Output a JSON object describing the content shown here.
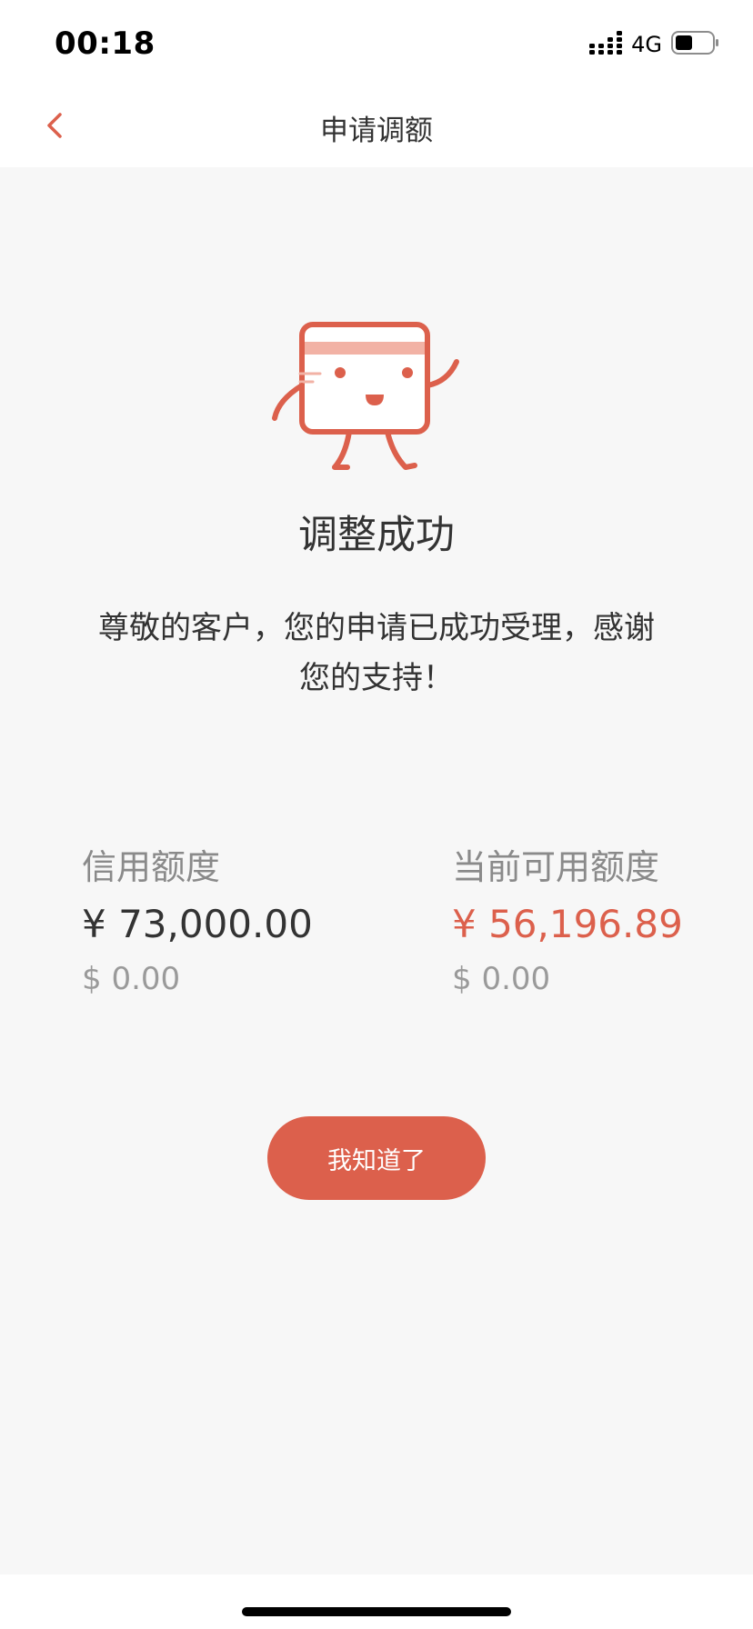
{
  "status_bar": {
    "time": "00:18",
    "network": "4G",
    "icons": [
      "signal-icon",
      "battery-icon"
    ]
  },
  "nav": {
    "title": "申请调额",
    "back_icon": "chevron-left-icon"
  },
  "result": {
    "illustration": "card-mascot-illustration",
    "title": "调整成功",
    "message": "尊敬的客户，您的申请已成功受理，感谢您的支持！"
  },
  "credit_limit": {
    "label": "信用额度",
    "cny": "¥ 73,000.00",
    "usd": "$ 0.00"
  },
  "available_limit": {
    "label": "当前可用额度",
    "cny": "¥ 56,196.89",
    "usd": "$ 0.00"
  },
  "actions": {
    "confirm_label": "我知道了"
  },
  "colors": {
    "accent": "#dc604c",
    "accent_light": "#f2b2a5",
    "background": "#f7f7f7",
    "text_primary": "#333333",
    "text_secondary": "#8a8a8a"
  }
}
